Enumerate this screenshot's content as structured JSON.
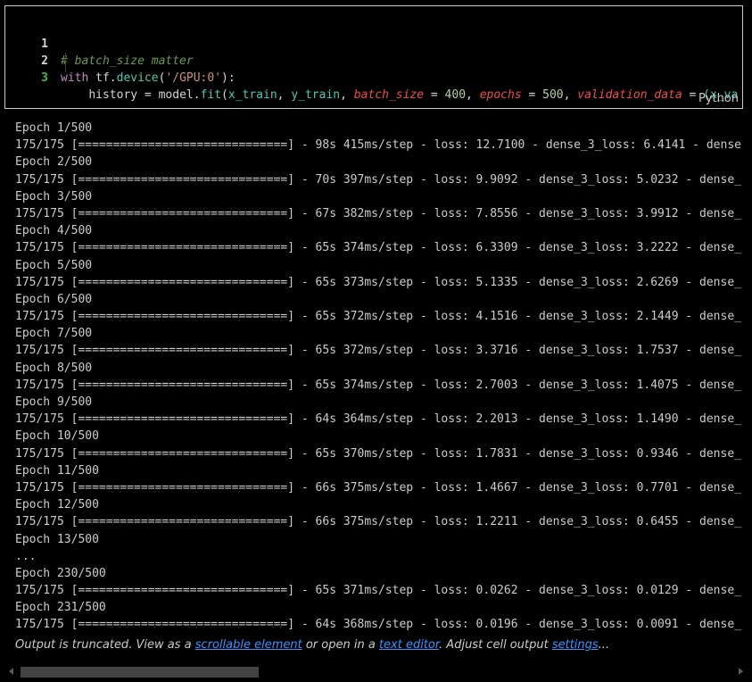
{
  "code_cell": {
    "language": "Python",
    "lines": [
      {
        "number": "1",
        "comment": "# batch_size matter"
      },
      {
        "number": "2",
        "kw": "with",
        "sp1": " ",
        "obj": "tf",
        "dot": ".",
        "fn": "device",
        "open": "(",
        "str": "'/GPU:0'",
        "close": "):"
      },
      {
        "number": "3",
        "indent": "    ",
        "var": "history",
        "eq": " = ",
        "model": "model",
        "dot": ".",
        "fn": "fit",
        "open": "(",
        "a1": "x_train",
        "c1": ", ",
        "a2": "y_train",
        "c2": ", ",
        "p1": "batch_size",
        "e1": " = ",
        "n1": "400",
        "c3": ", ",
        "p2": "epochs",
        "e2": " = ",
        "n2": "500",
        "c4": ", ",
        "p3": "validation_data",
        "e3": " = ",
        "tail": "(x_va"
      }
    ]
  },
  "output": {
    "lines": [
      "Epoch 1/500",
      "175/175 [==============================] - 98s 415ms/step - loss: 12.7100 - dense_3_loss: 6.4141 - dense",
      "Epoch 2/500",
      "175/175 [==============================] - 70s 397ms/step - loss: 9.9092 - dense_3_loss: 5.0232 - dense_",
      "Epoch 3/500",
      "175/175 [==============================] - 67s 382ms/step - loss: 7.8556 - dense_3_loss: 3.9912 - dense_",
      "Epoch 4/500",
      "175/175 [==============================] - 65s 374ms/step - loss: 6.3309 - dense_3_loss: 3.2222 - dense_",
      "Epoch 5/500",
      "175/175 [==============================] - 65s 373ms/step - loss: 5.1335 - dense_3_loss: 2.6269 - dense_",
      "Epoch 6/500",
      "175/175 [==============================] - 65s 372ms/step - loss: 4.1516 - dense_3_loss: 2.1449 - dense_",
      "Epoch 7/500",
      "175/175 [==============================] - 65s 372ms/step - loss: 3.3716 - dense_3_loss: 1.7537 - dense_",
      "Epoch 8/500",
      "175/175 [==============================] - 65s 374ms/step - loss: 2.7003 - dense_3_loss: 1.4075 - dense_",
      "Epoch 9/500",
      "175/175 [==============================] - 64s 364ms/step - loss: 2.2013 - dense_3_loss: 1.1490 - dense_",
      "Epoch 10/500",
      "175/175 [==============================] - 65s 370ms/step - loss: 1.7831 - dense_3_loss: 0.9346 - dense_",
      "Epoch 11/500",
      "175/175 [==============================] - 66s 375ms/step - loss: 1.4667 - dense_3_loss: 0.7701 - dense_",
      "Epoch 12/500",
      "175/175 [==============================] - 66s 375ms/step - loss: 1.2211 - dense_3_loss: 0.6455 - dense_",
      "Epoch 13/500",
      "...",
      "Epoch 230/500",
      "175/175 [==============================] - 65s 371ms/step - loss: 0.0262 - dense_3_loss: 0.0129 - dense_",
      "Epoch 231/500",
      "175/175 [==============================] - 64s 368ms/step - loss: 0.0196 - dense_3_loss: 0.0091 - dense_"
    ],
    "truncation": {
      "prefix": "Output is truncated. View as a ",
      "link_scrollable": "scrollable element",
      "middle": " or open in a ",
      "link_editor": "text editor",
      "middle2": ". Adjust cell output ",
      "link_settings": "settings",
      "suffix": "..."
    }
  },
  "scrollbar": {
    "left_icon": "chevron-left-icon",
    "right_icon": "chevron-right-icon",
    "thumb_position_fraction": 0.0,
    "thumb_size_fraction": 0.33
  },
  "colors": {
    "background": "#000000",
    "border": "#c8c8c8",
    "link": "#3794ff",
    "comment": "#6a9955",
    "keyword": "#c586c0",
    "string": "#ce9178",
    "function": "#4ec9b0",
    "parameter": "#f14c4c",
    "number": "#b5cea8"
  }
}
